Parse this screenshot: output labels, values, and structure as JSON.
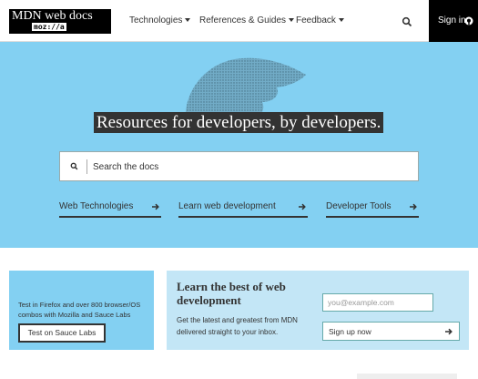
{
  "header": {
    "logo": {
      "title": "MDN web docs",
      "subtitle": "moz://a"
    },
    "nav": [
      {
        "label": "Technologies"
      },
      {
        "label": "References & Guides"
      },
      {
        "label": "Feedback"
      }
    ],
    "search_icon": "search-icon",
    "signin": {
      "label": "Sign in",
      "icon": "github-icon"
    }
  },
  "hero": {
    "title": "Resources for developers, by developers.",
    "search": {
      "placeholder": "Search the docs",
      "icon": "search-icon"
    },
    "links": [
      {
        "label": "Web Technologies",
        "icon": "arrow-right-icon"
      },
      {
        "label": "Learn web development",
        "icon": "arrow-right-icon"
      },
      {
        "label": "Developer Tools",
        "icon": "arrow-right-icon"
      }
    ],
    "background_color": "#83d0f2"
  },
  "promo": {
    "text": "Test in Firefox and over 800 browser/OS combos with Mozilla and Sauce Labs",
    "button": "Test on Sauce Labs"
  },
  "newsletter": {
    "title": "Learn the best of web development",
    "body": "Get the latest and greatest from MDN delivered straight to your inbox.",
    "email_placeholder": "you@example.com",
    "button": "Sign up now",
    "background_color": "#c3e6f6"
  }
}
